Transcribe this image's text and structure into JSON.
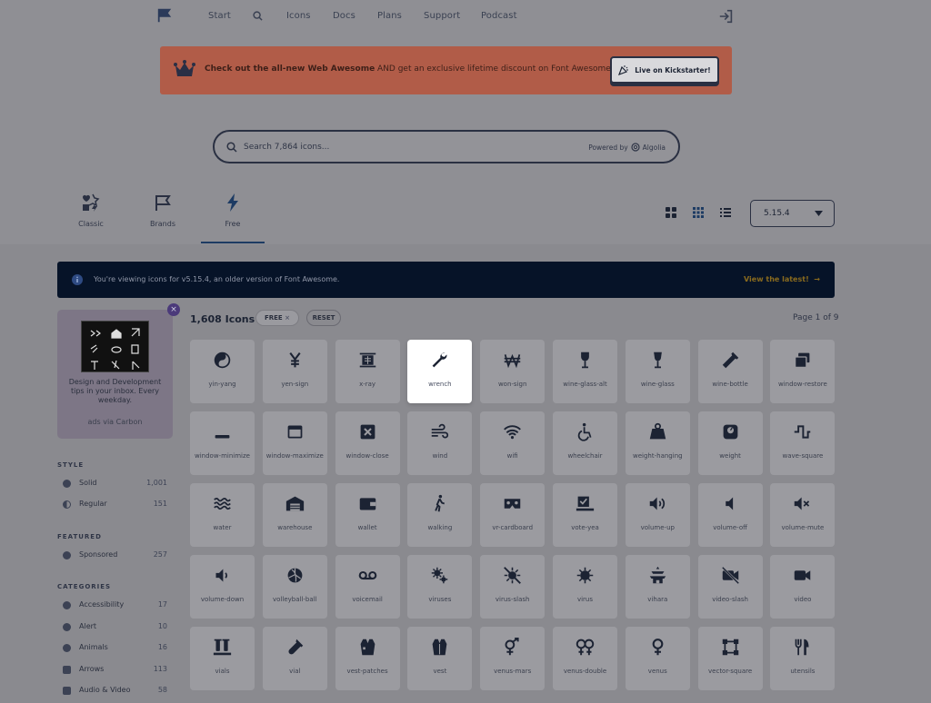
{
  "nav": {
    "start": "Start",
    "icons": "Icons",
    "docs": "Docs",
    "plans": "Plans",
    "support": "Support",
    "podcast": "Podcast"
  },
  "banner": {
    "bold_text": "Check out the all-new Web Awesome",
    "text": " AND get an exclusive lifetime discount on Font Awesome Pro!",
    "button": "Live on Kickstarter!",
    "color": "#b15c48"
  },
  "search": {
    "placeholder": "Search 7,864 icons...",
    "powered_by": "Powered by",
    "provider": "Algolia"
  },
  "tabs": [
    {
      "label": "Classic",
      "icon": "icons-icon"
    },
    {
      "label": "Brands",
      "icon": "flag-icon"
    },
    {
      "label": "Free",
      "icon": "bolt-icon",
      "active": true
    }
  ],
  "version": "5.15.4",
  "notice": {
    "text": "You're viewing icons for v5.15.4, an older version of Font Awesome.",
    "link": "View the latest!"
  },
  "ad": {
    "text": "Design and Development tips in your inbox. Every weekday.",
    "via": "ads via Carbon"
  },
  "sidebar": {
    "style_heading": "STYLE",
    "style": [
      {
        "label": "Solid",
        "count": "1,001"
      },
      {
        "label": "Regular",
        "count": "151"
      }
    ],
    "featured_heading": "FEATURED",
    "featured": [
      {
        "label": "Sponsored",
        "count": "257"
      }
    ],
    "categories_heading": "CATEGORIES",
    "categories": [
      {
        "label": "Accessibility",
        "count": "17"
      },
      {
        "label": "Alert",
        "count": "10"
      },
      {
        "label": "Animals",
        "count": "16"
      },
      {
        "label": "Arrows",
        "count": "113"
      },
      {
        "label": "Audio & Video",
        "count": "58"
      }
    ]
  },
  "results": {
    "count": "1,608 Icons",
    "filter": "FREE",
    "reset": "RESET",
    "page": "Page 1 of 9"
  },
  "icons": [
    "yin-yang",
    "yen-sign",
    "x-ray",
    "wrench",
    "won-sign",
    "wine-glass-alt",
    "wine-glass",
    "wine-bottle",
    "window-restore",
    "window-minimize",
    "window-maximize",
    "window-close",
    "wind",
    "wifi",
    "wheelchair",
    "weight-hanging",
    "weight",
    "wave-square",
    "water",
    "warehouse",
    "wallet",
    "walking",
    "vr-cardboard",
    "vote-yea",
    "volume-up",
    "volume-off",
    "volume-mute",
    "volume-down",
    "volleyball-ball",
    "voicemail",
    "viruses",
    "virus-slash",
    "virus",
    "vihara",
    "video-slash",
    "video",
    "vials",
    "vial",
    "vest-patches",
    "vest",
    "venus-mars",
    "venus-double",
    "venus",
    "vector-square",
    "utensils"
  ],
  "selected_icon": "wrench"
}
